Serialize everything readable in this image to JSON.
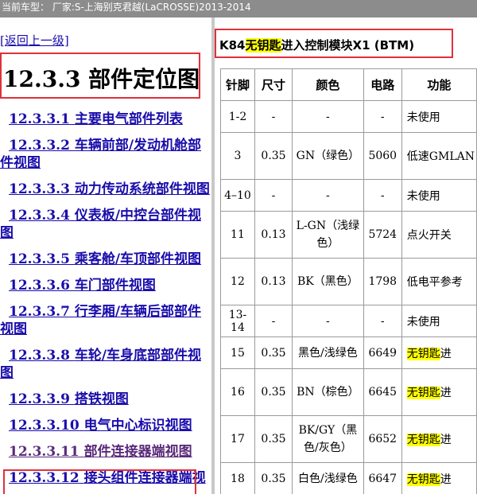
{
  "topbar": {
    "text": "当前车型： 厂家:S-上海别克君越(LaCROSSE)2013-2014"
  },
  "nav": {
    "back_label": "[返回上一级]",
    "page_title": "12.3.3 部件定位图",
    "items": [
      {
        "num": "12.3.3.1",
        "label": "主要电气部件列表"
      },
      {
        "num": "12.3.3.2",
        "label": "车辆前部/发动机舱部件视图"
      },
      {
        "num": "12.3.3.3",
        "label": "动力传动系统部件视图"
      },
      {
        "num": "12.3.3.4",
        "label": "仪表板/中控台部件视图"
      },
      {
        "num": "12.3.3.5",
        "label": "乘客舱/车顶部件视图"
      },
      {
        "num": "12.3.3.6",
        "label": "车门部件视图"
      },
      {
        "num": "12.3.3.7",
        "label": "行李厢/车辆后部部件视图"
      },
      {
        "num": "12.3.3.8",
        "label": "车轮/车身底部部件视图"
      },
      {
        "num": "12.3.3.9",
        "label": "搭铁视图"
      },
      {
        "num": "12.3.3.10",
        "label": "电气中心标识视图"
      },
      {
        "num": "12.3.3.11",
        "label": "部件连接器端视图"
      },
      {
        "num": "12.3.3.12",
        "label": "接头组件连接器端视"
      }
    ]
  },
  "module": {
    "prefix": "K84",
    "highlight": "无钥匙",
    "suffix": "进入控制模块X1 (BTM)"
  },
  "table": {
    "headers": [
      "针脚",
      "尺寸",
      "颜色",
      "电路",
      "功能"
    ],
    "rows": [
      {
        "pin": "1-2",
        "size": "-",
        "color": "-",
        "circuit": "-",
        "desc_hl": "",
        "desc": "未使用"
      },
      {
        "pin": "3",
        "size": "0.35",
        "color": "GN（绿色）",
        "circuit": "5060",
        "desc_hl": "",
        "desc": "低速GMLAN"
      },
      {
        "pin": "4–10",
        "size": "-",
        "color": "-",
        "circuit": "-",
        "desc_hl": "",
        "desc": "未使用"
      },
      {
        "pin": "11",
        "size": "0.13",
        "color": "L-GN（浅绿色）",
        "circuit": "5724",
        "desc_hl": "",
        "desc": "点火开关"
      },
      {
        "pin": "12",
        "size": "0.13",
        "color": "BK（黑色）",
        "circuit": "1798",
        "desc_hl": "",
        "desc": "低电平参考"
      },
      {
        "pin": "13-14",
        "size": "-",
        "color": "-",
        "circuit": "-",
        "desc_hl": "",
        "desc": "未使用"
      },
      {
        "pin": "15",
        "size": "0.35",
        "color": "黑色/浅绿色",
        "circuit": "6649",
        "desc_hl": "无钥匙",
        "desc": "进"
      },
      {
        "pin": "16",
        "size": "0.35",
        "color": "BN（棕色）",
        "circuit": "6645",
        "desc_hl": "无钥匙",
        "desc": "进"
      },
      {
        "pin": "17",
        "size": "0.35",
        "color": "BK/GY（黑色/灰色）",
        "circuit": "6652",
        "desc_hl": "无钥匙",
        "desc": "进"
      },
      {
        "pin": "18",
        "size": "0.35",
        "color": "白色/浅绿色",
        "circuit": "6647",
        "desc_hl": "无钥匙",
        "desc": "进"
      }
    ]
  }
}
